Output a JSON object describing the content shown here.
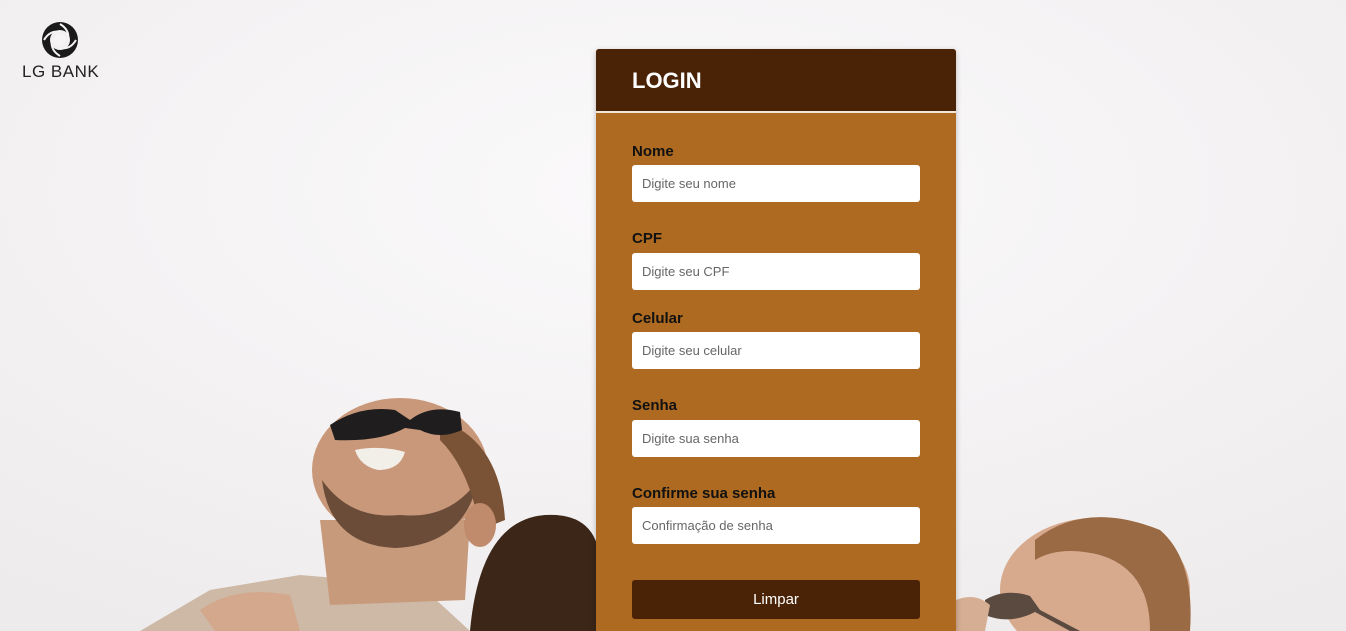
{
  "brand": {
    "name": "LG BANK",
    "logo_icon": "swirl-logo-icon"
  },
  "login_form": {
    "title": "LOGIN",
    "fields": [
      {
        "label": "Nome",
        "placeholder": "Digite seu nome",
        "value": ""
      },
      {
        "label": "CPF",
        "placeholder": "Digite seu CPF",
        "value": ""
      },
      {
        "label": "Celular",
        "placeholder": "Digite seu celular",
        "value": ""
      },
      {
        "label": "Senha",
        "placeholder": "Digite sua senha",
        "value": ""
      },
      {
        "label": "Confirme sua senha",
        "placeholder": "Confirmação de senha",
        "value": ""
      }
    ],
    "clear_button_label": "Limpar"
  },
  "colors": {
    "card_background": "#ad6a20",
    "header_background": "#4a2206",
    "button_background": "#4a2206"
  }
}
